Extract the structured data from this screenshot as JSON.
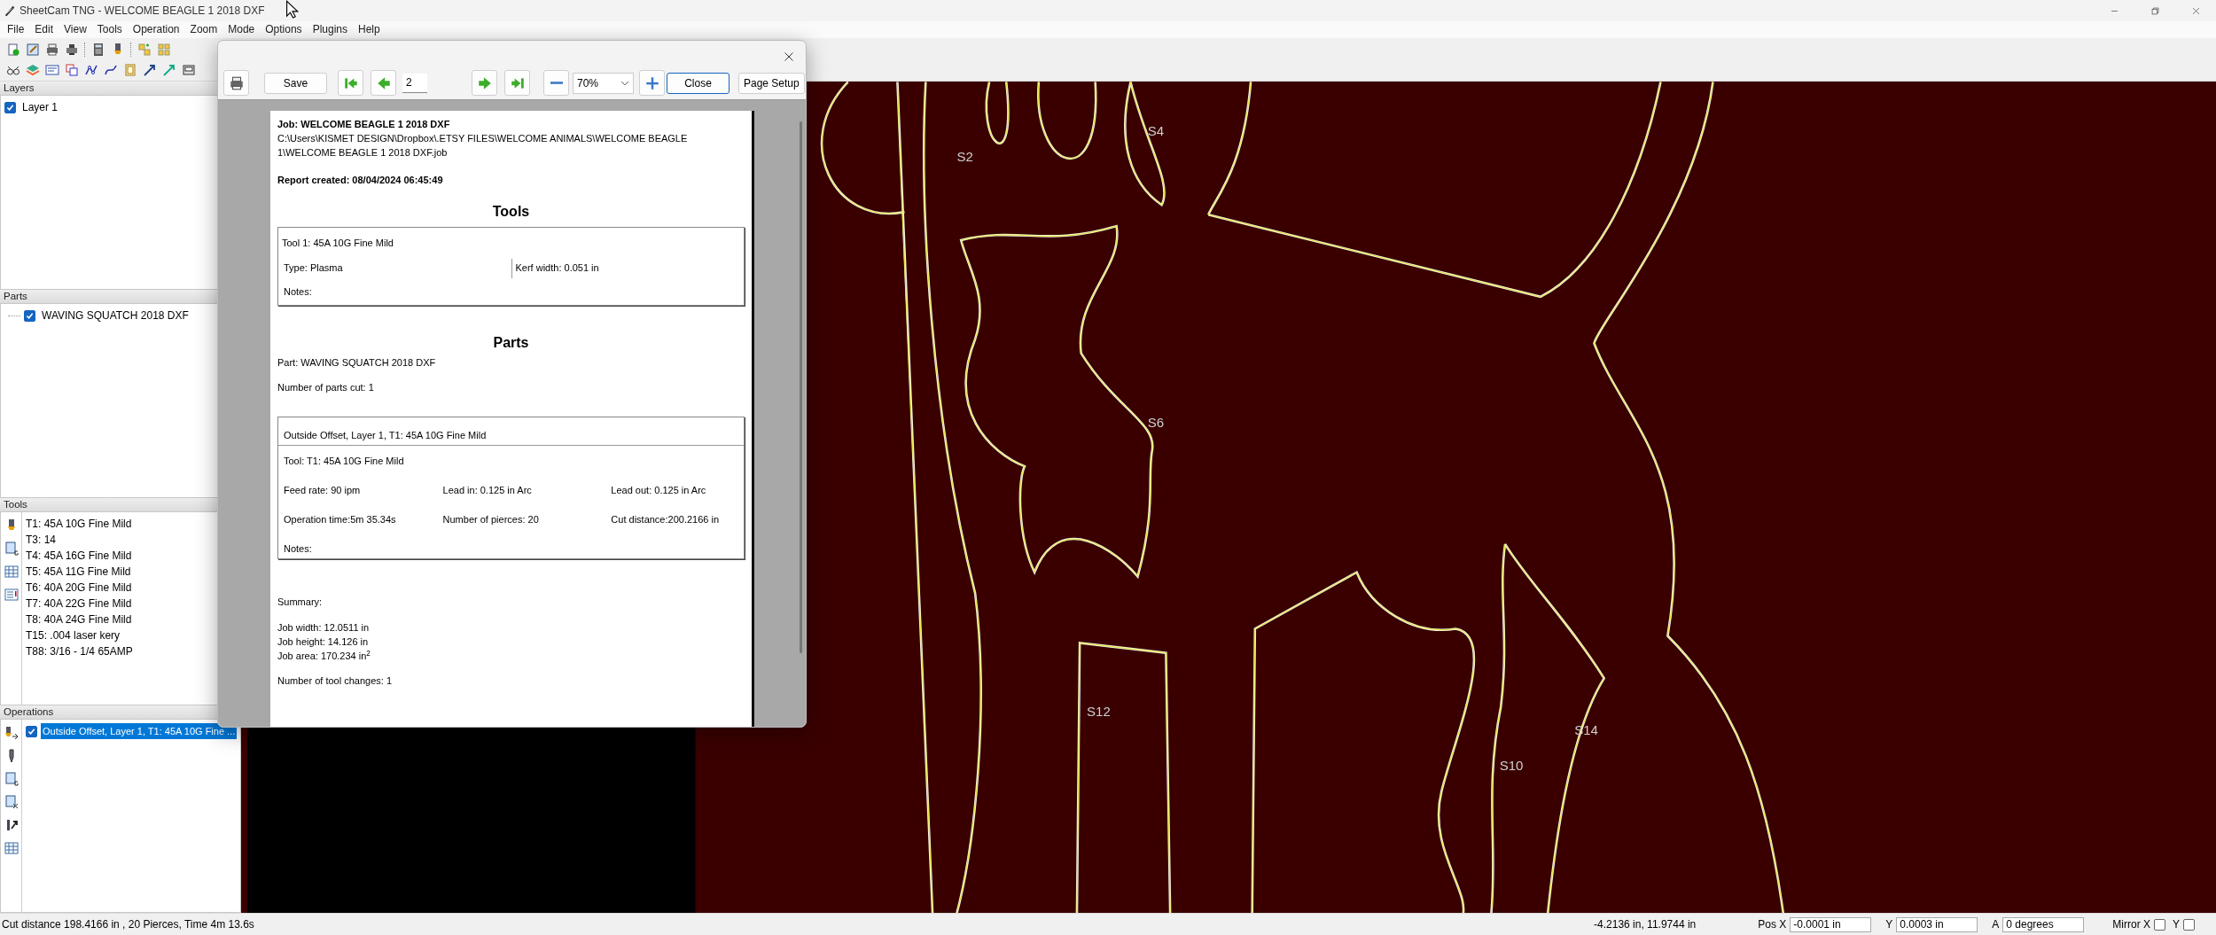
{
  "window": {
    "title": "SheetCam TNG - WELCOME BEAGLE 1 2018 DXF"
  },
  "menu": [
    "File",
    "Edit",
    "View",
    "Tools",
    "Operation",
    "Zoom",
    "Mode",
    "Options",
    "Plugins",
    "Help"
  ],
  "layers": {
    "title": "Layers",
    "items": [
      {
        "label": "Layer 1",
        "checked": true
      }
    ]
  },
  "parts": {
    "title": "Parts",
    "items": [
      {
        "label": "WAVING SQUATCH 2018 DXF",
        "checked": true
      }
    ]
  },
  "tools": {
    "title": "Tools",
    "items": [
      "T1: 45A 10G Fine Mild",
      "T3: 14",
      "T4: 45A 16G Fine Mild",
      "T5: 45A 11G Fine Mild",
      "T6: 40A 20G Fine Mild",
      "T7: 40A 22G Fine Mild",
      "T8: 40A 24G Fine Mild",
      "T15: .004 laser kery",
      "T88: 3/16 - 1/4 65AMP"
    ]
  },
  "operations": {
    "title": "Operations",
    "items": [
      {
        "label": "Outside Offset, Layer 1, T1: 45A 10G Fine ...",
        "checked": true,
        "selected": true
      }
    ]
  },
  "canvas": {
    "labels": [
      "S2",
      "S4",
      "S6",
      "S12",
      "S10",
      "S14"
    ]
  },
  "print_preview": {
    "toolbar": {
      "save": "Save",
      "page": "2",
      "zoom": "70%",
      "close": "Close",
      "page_setup": "Page Setup"
    },
    "report": {
      "job": "Job: WELCOME BEAGLE 1 2018 DXF",
      "path": "C:\\Users\\KISMET DESIGN\\Dropbox\\.ETSY FILES\\WELCOME ANIMALS\\WELCOME BEAGLE 1\\WELCOME BEAGLE 1 2018 DXF.job",
      "created": "Report created: 08/04/2024 06:45:49",
      "tools_heading": "Tools",
      "tool": {
        "name": "Tool 1: 45A 10G Fine Mild",
        "type": "Type: Plasma",
        "kerf": "Kerf width: 0.051 in",
        "notes": "Notes:"
      },
      "parts_heading": "Parts",
      "part": "Part: WAVING SQUATCH 2018 DXF",
      "parts_cut": "Number of parts cut: 1",
      "operation": {
        "title": "Outside Offset, Layer 1, T1: 45A 10G Fine Mild",
        "tool": "Tool: T1: 45A 10G Fine Mild",
        "fields": [
          "Feed rate: 90 ipm",
          "Lead in: 0.125 in Arc",
          "Lead out: 0.125 in Arc",
          "Operation time:5m 35.34s",
          "Number of pierces: 20",
          "Cut distance:200.2166 in"
        ],
        "notes": "Notes:"
      },
      "summary_heading": "Summary:",
      "summary": [
        "Job width: 12.0511 in",
        "Job height: 14.126 in",
        "Job area: 170.234 in$^{2}$"
      ],
      "tool_changes": "Number of tool changes: 1"
    }
  },
  "status_bar": {
    "summary": "Cut distance 198.4166 in , 20 Pierces, Time 4m 13.6s",
    "coordinates": "-4.2136 in, 11.9744 in",
    "pos_x_label": "Pos X",
    "pos_x": "-0.0001 in",
    "y_label": "Y",
    "y": "0.0003 in",
    "a_label": "A",
    "a": "0 degrees",
    "mirror_x_label": "Mirror X",
    "mirror_x": false,
    "mirror_y_label": "Y",
    "mirror_y": false
  }
}
